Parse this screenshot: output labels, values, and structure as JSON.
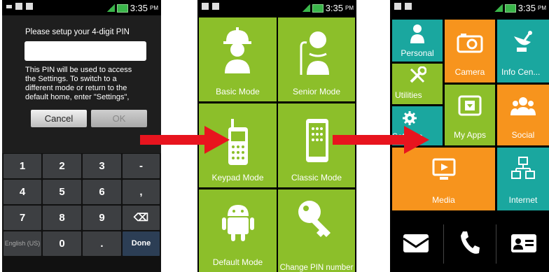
{
  "status_bar": {
    "time": "3:35",
    "ampm": "PM"
  },
  "pin_screen": {
    "title": "Please setup your 4-digit PIN",
    "info_lines": [
      "This PIN will be used to access",
      "the Settings. To switch to a",
      "different mode or return to the",
      "default home, enter \"Settings\","
    ],
    "cancel_label": "Cancel",
    "ok_label": "OK",
    "keyboard": {
      "row1": [
        "1",
        "2",
        "3",
        "-"
      ],
      "row2": [
        "4",
        "5",
        "6",
        ","
      ],
      "row3": [
        "7",
        "8",
        "9",
        "⌫"
      ],
      "row4": [
        "English (US)",
        "0",
        ".",
        "Done"
      ]
    }
  },
  "mode_screen": {
    "tiles": [
      "Basic Mode",
      "Senior Mode",
      "Keypad Mode",
      "Classic Mode",
      "Default Mode",
      "Change PIN number"
    ]
  },
  "home_screen": {
    "tiles": [
      "Personal",
      "Camera",
      "Info Cen...",
      "Utilities",
      "My Apps",
      "Settings",
      "Social",
      "Media",
      "Internet"
    ],
    "dock": [
      "envelope-icon",
      "phone-icon",
      "contact-card-icon"
    ]
  },
  "colors": {
    "green": "#8cbf2a",
    "teal": "#1aa79f",
    "orange": "#f7941d",
    "arrow": "#e8141e"
  }
}
